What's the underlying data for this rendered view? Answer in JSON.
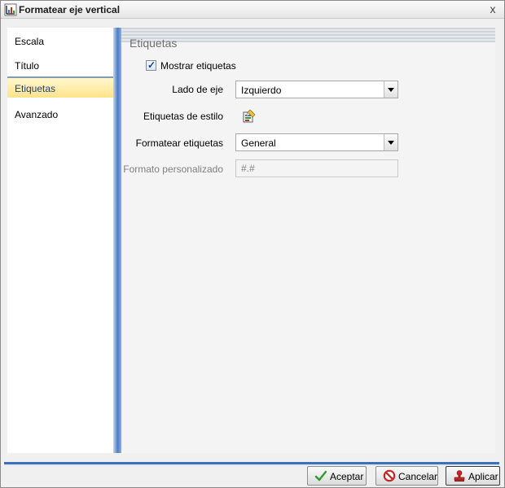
{
  "window": {
    "title": "Formatear eje vertical",
    "close_glyph": "x"
  },
  "nav": {
    "items": [
      {
        "label": "Escala"
      },
      {
        "label": "Título"
      },
      {
        "label": "Etiquetas",
        "selected": true
      },
      {
        "label": "Avanzado"
      }
    ]
  },
  "panel": {
    "title": "Etiquetas",
    "show_labels": {
      "label": "Mostrar etiquetas",
      "checked": true
    },
    "axis_side": {
      "label": "Lado de eje",
      "value": "Izquierdo"
    },
    "label_style": {
      "label": "Etiquetas de estilo",
      "icon": "style-edit-icon"
    },
    "format_labels": {
      "label": "Formatear etiquetas",
      "value": "General"
    },
    "custom_format": {
      "label": "Formato personalizado",
      "value": "#.#"
    }
  },
  "footer": {
    "ok_label": "Aceptar",
    "cancel_label": "Cancelar",
    "apply_label": "Aplicar"
  },
  "colors": {
    "accent_blue": "#3d6fbf",
    "selected_bg": "#ffe38a",
    "ok_green": "#2e9a2e",
    "cancel_red": "#c62828"
  }
}
